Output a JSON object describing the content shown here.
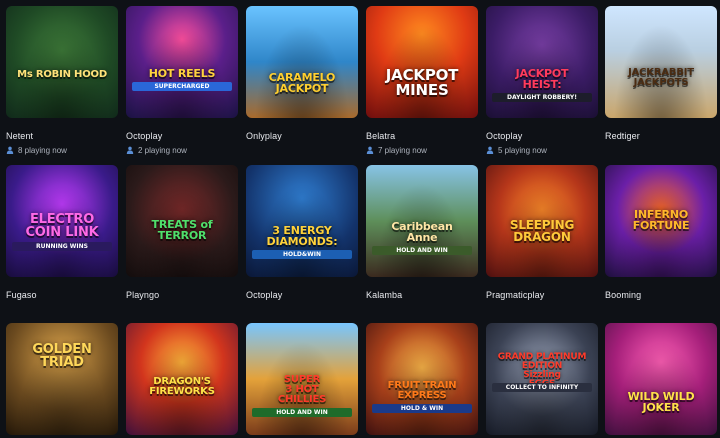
{
  "games": [
    {
      "provider": "Netent",
      "playing": "8 playing now",
      "title": "Ms ROBIN HOOD",
      "sub": "",
      "theme": "robin"
    },
    {
      "provider": "Octoplay",
      "playing": "2 playing now",
      "title": "HOT REELS",
      "sub": "SUPERCHARGED",
      "theme": "hotreels"
    },
    {
      "provider": "Onlyplay",
      "playing": "",
      "title": "CARAMELO\nJACKPOT",
      "sub": "",
      "theme": "caramelo"
    },
    {
      "provider": "Belatra",
      "playing": "7 playing now",
      "title": "JACKPOT\nMINES",
      "sub": "",
      "theme": "mines"
    },
    {
      "provider": "Octoplay",
      "playing": "5 playing now",
      "title": "JACKPOT\nHEIST:",
      "sub": "DAYLIGHT ROBBERY!",
      "theme": "heist"
    },
    {
      "provider": "Redtiger",
      "playing": "",
      "title": "JACKRABBIT\nJACKPOTS",
      "sub": "",
      "theme": "jackrabbit"
    },
    {
      "provider": "Fugaso",
      "playing": "",
      "title": "ELECTRO\nCOIN LINK",
      "sub": "RUNNING WINS",
      "theme": "electro"
    },
    {
      "provider": "Playngo",
      "playing": "",
      "title": "TREATS of\nTERROR",
      "sub": "",
      "theme": "treats"
    },
    {
      "provider": "Octoplay",
      "playing": "",
      "title": "3 ENERGY\nDIAMONDS:",
      "sub": "HOLD&WIN",
      "theme": "diamonds"
    },
    {
      "provider": "Kalamba",
      "playing": "",
      "title": "Caribbean\nAnne",
      "sub": "HOLD AND WIN",
      "theme": "anne"
    },
    {
      "provider": "Pragmaticplay",
      "playing": "",
      "title": "SLEEPING\nDRAGON",
      "sub": "",
      "theme": "dragon"
    },
    {
      "provider": "Booming",
      "playing": "",
      "title": "INFERNO\nFORTUNE",
      "sub": "",
      "theme": "inferno"
    },
    {
      "provider": "",
      "playing": "",
      "title": "GOLDEN\nTRIAD",
      "sub": "",
      "theme": "triad"
    },
    {
      "provider": "",
      "playing": "",
      "title": "DRAGON'S\nFIREWORKS",
      "sub": "",
      "theme": "fireworks"
    },
    {
      "provider": "",
      "playing": "",
      "title": "SUPER\n3 HOT\nCHILLIES",
      "sub": "HOLD AND WIN",
      "theme": "chillies"
    },
    {
      "provider": "",
      "playing": "",
      "title": "FRUIT TRAIN\nEXPRESS",
      "sub": "HOLD & WIN",
      "theme": "train"
    },
    {
      "provider": "",
      "playing": "",
      "title": "GRAND PLATINUM EDITION\nSizzling\nEGGS",
      "sub": "COLLECT TO INFINITY",
      "theme": "eggs"
    },
    {
      "provider": "",
      "playing": "",
      "title": "WILD WILD\nJOKER",
      "sub": "",
      "theme": "joker"
    }
  ],
  "colors": {
    "background": "#0e1116",
    "provider_text": "#e8eaee",
    "playing_text": "#aeb4be",
    "user_icon": "#5b8fd6"
  },
  "icons": {
    "playing": "user-icon"
  }
}
